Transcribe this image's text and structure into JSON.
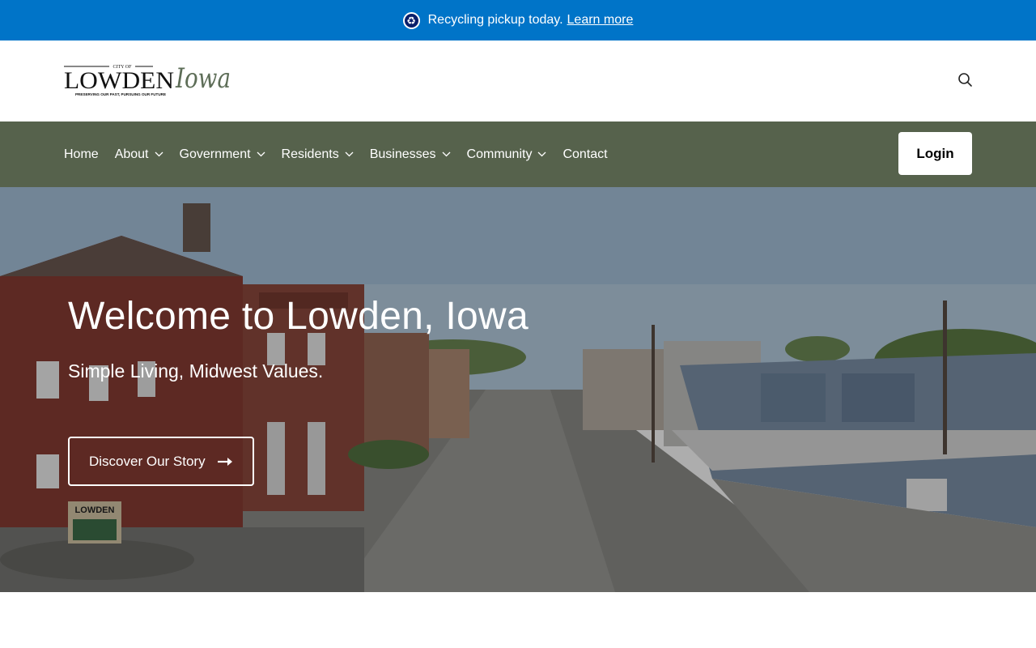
{
  "alert": {
    "icon": "recycle-icon",
    "message": "Recycling pickup today.",
    "link_text": "Learn more",
    "background": "#0074c8"
  },
  "header": {
    "logo": {
      "top_text": "CITY OF",
      "main_text": "LOWDEN",
      "script_text": "Iowa",
      "tagline": "PRESERVING OUR PAST, PURSUING OUR FUTURE"
    },
    "search_icon": "search-icon"
  },
  "nav": {
    "background": "#56624c",
    "items": [
      {
        "label": "Home",
        "has_dropdown": false
      },
      {
        "label": "About",
        "has_dropdown": true
      },
      {
        "label": "Government",
        "has_dropdown": true
      },
      {
        "label": "Residents",
        "has_dropdown": true
      },
      {
        "label": "Businesses",
        "has_dropdown": true
      },
      {
        "label": "Community",
        "has_dropdown": true
      },
      {
        "label": "Contact",
        "has_dropdown": false
      }
    ],
    "login_label": "Login"
  },
  "hero": {
    "title": "Welcome to Lowden, Iowa",
    "subtitle": "Simple Living, Midwest Values.",
    "cta_label": "Discover Our Story",
    "sign_text": "LOWDEN"
  }
}
